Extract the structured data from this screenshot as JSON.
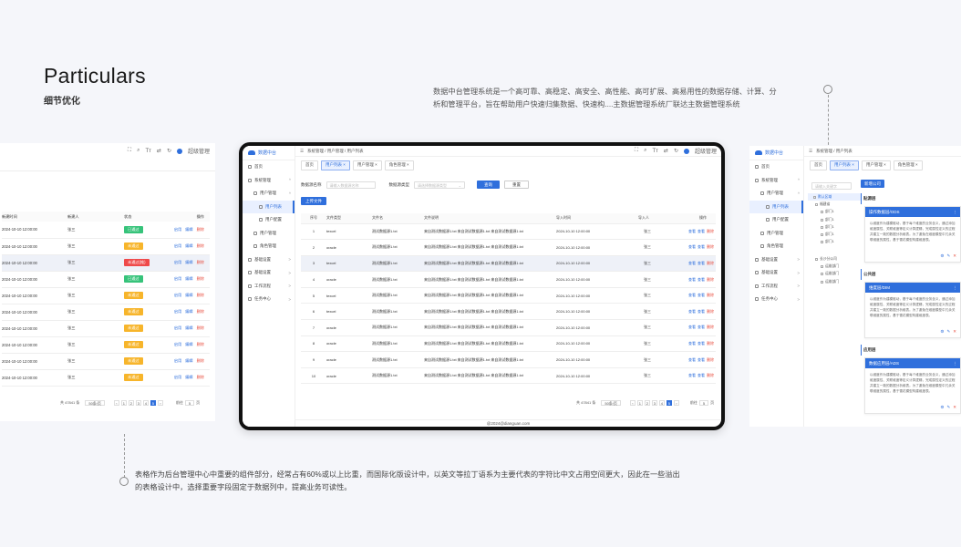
{
  "header": {
    "title": "Particulars",
    "subtitle": "细节优化"
  },
  "desc_top": "数据中台管理系统是一个高可靠、高稳定、高安全、高性能、高可扩展、高易用性的数据存储、计算、分析和管理平台，旨在帮助用户快速归集数据、快速构....主数据管理系统厂联达主数据管理系统",
  "desc_bottom": "表格作为后台管理中心中重要的组件部分，经常占有60%或以上比重，而国际化版设计中，以英文等拉丁语系为主要代表的字符比中文占用空间更大，因此在一些溢出的表格设计中，选择重要字段固定于数据列中，提高业务可读性。",
  "colors": {
    "primary": "#2f6fdc",
    "danger": "#e84c3d",
    "success": "#36c37a",
    "warning": "#f7b52b"
  },
  "topbar": {
    "icons": [
      "expand-icon",
      "search-icon",
      "font-size-icon",
      "translate-icon",
      "refresh-icon"
    ],
    "user": "超级管理"
  },
  "left": {
    "headers": {
      "time": "新建时间",
      "creator": "新建人",
      "status": "状态",
      "ops": "操作"
    },
    "ops": [
      "启用",
      "编辑",
      "删除"
    ],
    "rows": [
      {
        "time": "2024-10-10 12:00:00",
        "creator": "张三",
        "status": "已通过",
        "tone": "green"
      },
      {
        "time": "2024-10-10 12:00:00",
        "creator": "张三",
        "status": "未通过",
        "tone": "orange"
      },
      {
        "time": "2024-10-10 12:00:00",
        "creator": "张三",
        "status": "未通过(推)",
        "tone": "red"
      },
      {
        "time": "2024-10-10 12:00:00",
        "creator": "张三",
        "status": "已通过",
        "tone": "green"
      },
      {
        "time": "2024-10-10 12:00:00",
        "creator": "张三",
        "status": "未通过",
        "tone": "orange"
      },
      {
        "time": "2024-10-10 12:00:00",
        "creator": "张三",
        "status": "未通过",
        "tone": "orange"
      },
      {
        "time": "2024-10-10 12:00:00",
        "creator": "张三",
        "status": "未通过",
        "tone": "orange"
      },
      {
        "time": "2024-10-10 12:00:00",
        "creator": "张三",
        "status": "未通过",
        "tone": "orange"
      },
      {
        "time": "2024-10-10 12:00:00",
        "creator": "张三",
        "status": "未通过",
        "tone": "orange"
      },
      {
        "time": "2024-10-10 12:00:00",
        "creator": "张三",
        "status": "未通过",
        "tone": "orange"
      }
    ],
    "pager": {
      "total": "共 47841 条",
      "size": "50条/页",
      "pages": [
        "1",
        "2",
        "3",
        "4",
        "5"
      ],
      "goto": "前往",
      "page": "5",
      "unit": "页"
    }
  },
  "center": {
    "logo": "数据中台",
    "breadcrumb": "系统管理 / 用户管理 / 用户列表",
    "nav": [
      {
        "label": "首页",
        "level": 0
      },
      {
        "label": "系统管理",
        "level": 0,
        "chev": "^"
      },
      {
        "label": "用户管理",
        "level": 1,
        "chev": "^"
      },
      {
        "label": "用户列表",
        "level": 2,
        "active": true
      },
      {
        "label": "用户配置",
        "level": 2
      },
      {
        "label": "用户管理",
        "level": 1
      },
      {
        "label": "角色管理",
        "level": 1
      },
      {
        "label": "基础设置",
        "level": 0,
        "chev": ">"
      },
      {
        "label": "基础设置",
        "level": 0,
        "chev": ">"
      },
      {
        "label": "工作流程",
        "level": 0,
        "chev": ">"
      },
      {
        "label": "任务中心",
        "level": 0,
        "chev": ">"
      }
    ],
    "tabs": [
      {
        "label": "首页",
        "on": false
      },
      {
        "label": "用户列表 ×",
        "on": true
      },
      {
        "label": "用户管理 ×",
        "on": false
      },
      {
        "label": "角色管理 ×",
        "on": false
      }
    ],
    "filter": {
      "name_label": "数据源名称",
      "name_ph": "请输入数据源名称",
      "type_label": "数据源类型",
      "type_ph": "请选择数据源类型",
      "search": "查询",
      "reset": "重置"
    },
    "upload": "上传文件",
    "headers": [
      "序号",
      "文件类型",
      "文件名",
      "文件说明",
      "导入时间",
      "导入人",
      "操作"
    ],
    "ops": [
      "查看",
      "查看",
      "删除"
    ],
    "rows": [
      {
        "no": "1",
        "type": "texcel",
        "name": "测试数据源1.txt",
        "note": "来自测试数据源1.txt 来自测试数据源1.txt 来自测试数据源1.txt",
        "time": "2024-10-10 12:00:00",
        "user": "张三"
      },
      {
        "no": "2",
        "type": "oracle",
        "name": "测试数据源1.txt",
        "note": "来自测试数据源1.txt 来自测试数据源1.txt 来自测试数据源1.txt",
        "time": "2024-10-10 12:00:00",
        "user": "张三"
      },
      {
        "no": "3",
        "type": "texcel",
        "name": "测试数据源1.txt",
        "note": "来自测试数据源1.txt 来自测试数据源1.txt 来自测试数据源1.txt",
        "time": "2024-10-10 12:00:00",
        "user": "张三",
        "hl": true
      },
      {
        "no": "4",
        "type": "oracle",
        "name": "测试数据源1.txt",
        "note": "来自测试数据源1.txt 来自测试数据源1.txt 来自测试数据源1.txt",
        "time": "2024-10-10 12:00:00",
        "user": "张三"
      },
      {
        "no": "5",
        "type": "texcel",
        "name": "测试数据源1.txt",
        "note": "来自测试数据源1.txt 来自测试数据源1.txt 来自测试数据源1.txt",
        "time": "2024-10-10 12:00:00",
        "user": "张三"
      },
      {
        "no": "6",
        "type": "texcel",
        "name": "测试数据源1.txt",
        "note": "来自测试数据源1.txt 来自测试数据源1.txt 来自测试数据源1.txt",
        "time": "2024-10-10 12:00:00",
        "user": "张三"
      },
      {
        "no": "7",
        "type": "oracle",
        "name": "测试数据源1.txt",
        "note": "来自测试数据源1.txt 来自测试数据源1.txt 来自测试数据源1.txt",
        "time": "2024-10-10 12:00:00",
        "user": "张三"
      },
      {
        "no": "8",
        "type": "oracle",
        "name": "测试数据源1.txt",
        "note": "来自测试数据源1.txt 来自测试数据源1.txt 来自测试数据源1.txt",
        "time": "2024-10-10 12:00:00",
        "user": "张三"
      },
      {
        "no": "9",
        "type": "oracle",
        "name": "测试数据源1.txt",
        "note": "来自测试数据源1.txt 来自测试数据源1.txt 来自测试数据源1.txt",
        "time": "2024-10-10 12:00:00",
        "user": "张三"
      },
      {
        "no": "10",
        "type": "oracle",
        "name": "测试数据源1.txt",
        "note": "来自测试数据源1.txt 来自测试数据源1.txt 来自测试数据源1.txt",
        "time": "2024-10-10 12:00:00",
        "user": "张三"
      }
    ],
    "pager": {
      "total": "共 47841 条",
      "size": "50条/页",
      "pages": [
        "1",
        "2",
        "3",
        "4",
        "5"
      ],
      "goto": "前往",
      "page": "5",
      "unit": "页"
    },
    "footer": "@2024@dianguan.com"
  },
  "right": {
    "logo": "数据中台",
    "breadcrumb": "系统管理 / 用户列表",
    "tabs": [
      {
        "label": "首页",
        "on": false
      },
      {
        "label": "用户列表 ×",
        "on": true
      },
      {
        "label": "用户管理 ×",
        "on": false
      },
      {
        "label": "角色管理 ×",
        "on": false
      }
    ],
    "new_btn": "新增公司",
    "search_ph": "请输入关键字",
    "tree": [
      "默认区域",
      "福建省",
      "部门1",
      "部门1",
      "部门1",
      "部门1",
      "部门1",
      "长沙分公司",
      "运维部门",
      "运维部门",
      "运维部门"
    ],
    "sections": [
      {
        "label": "贴源层",
        "card": "操作数据层/ODS"
      },
      {
        "label": "公共层",
        "card": "维度层/DIM"
      },
      {
        "label": "应用层",
        "card": "数据应用层/ADS"
      }
    ],
    "card_text": "以维度作为建模驱动，基于每个维度的业务含义，通过添加维度属性、关联维度等定义计算逻辑，完成属性定义的过程并建立一致的数据分析维表。为了避免在维度模型中冗余关联维度的属性，基于雪花模型构建维度表。"
  }
}
